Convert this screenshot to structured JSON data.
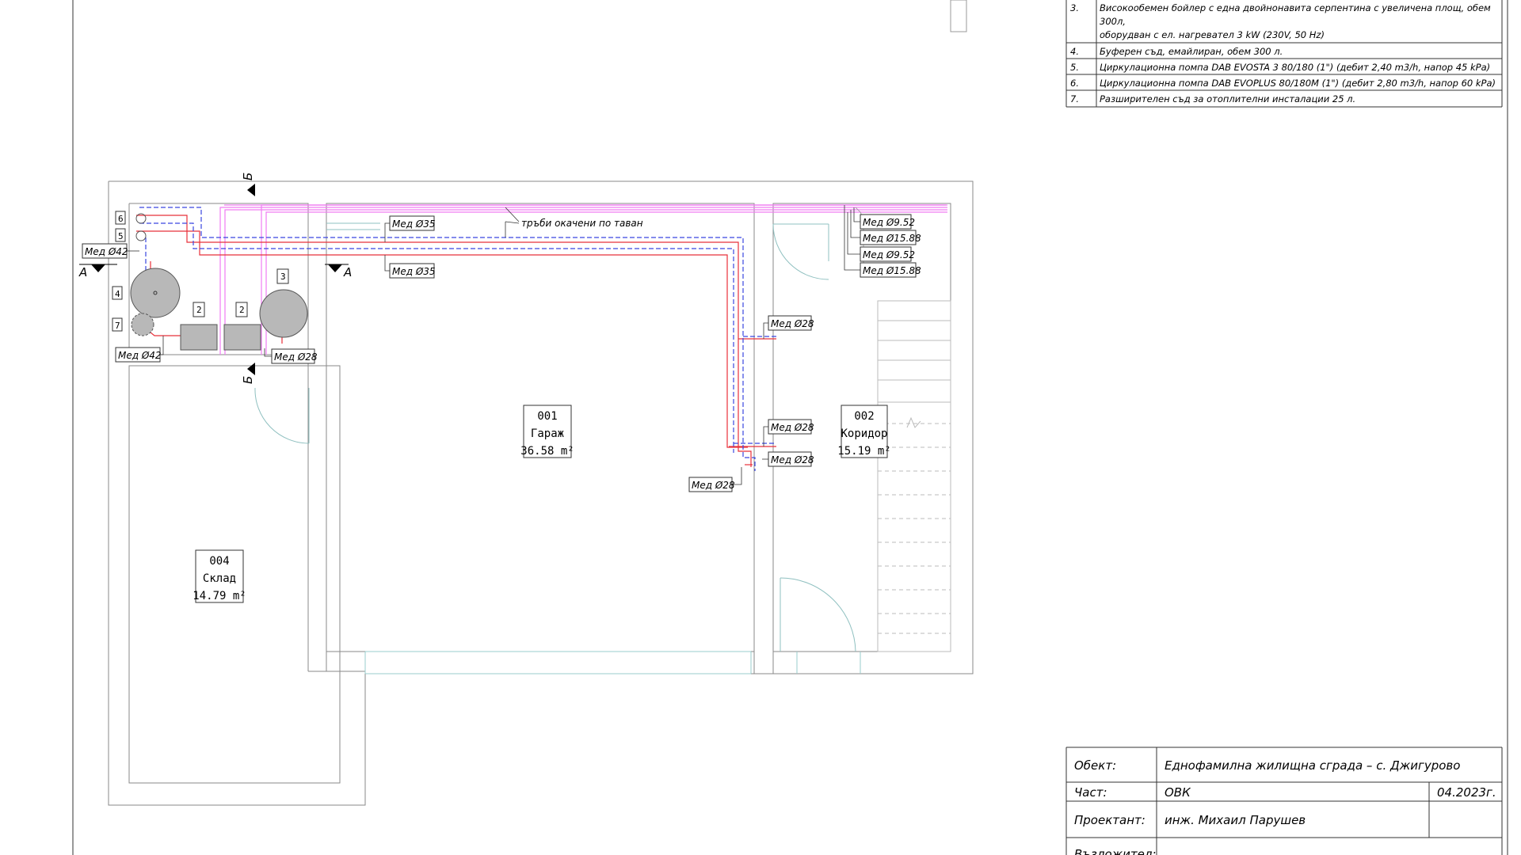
{
  "legend": {
    "rows": [
      {
        "no": "3.",
        "lines": [
          "Високообемен бойлер с една двойнонавита серпентина с увеличена площ, обем",
          "300л,",
          "оборудван с ел. нагревател 3 kW (230V, 50 Hz)"
        ]
      },
      {
        "no": "4.",
        "lines": [
          "Буферен съд, емайлиран, обем 300 л."
        ]
      },
      {
        "no": "5.",
        "lines": [
          "Циркулационна помпа DAB EVOSTA 3 80/180 (1\") (дебит 2,40 m3/h, напор 45 kPa)"
        ]
      },
      {
        "no": "6.",
        "lines": [
          "Циркулационна помпа DAB EVOPLUS 80/180M (1\") (дебит 2,80 m3/h, напор 60 kPa)"
        ]
      },
      {
        "no": "7.",
        "lines": [
          "Разширителен съд за отоплителни инсталации 25 л."
        ]
      }
    ]
  },
  "rooms": {
    "r001": {
      "num": "001",
      "name": "Гараж",
      "area": "36.58 m²"
    },
    "r002": {
      "num": "002",
      "name": "Коридор",
      "area": "15.19 m²"
    },
    "r004": {
      "num": "004",
      "name": "Склад",
      "area": "14.79 m²"
    }
  },
  "labels": {
    "ceiling_note": "тръби окачени по таван",
    "pipe_35a": "Мед Ø35",
    "pipe_35b": "Мед Ø35",
    "pipe_952a": "Мед Ø9.52",
    "pipe_1588a": "Мед Ø15.88",
    "pipe_952b": "Мед Ø9.52",
    "pipe_1588b": "Мед Ø15.88",
    "pipe_28a": "Мед Ø28",
    "pipe_28b": "Мед Ø28",
    "pipe_28c": "Мед Ø28",
    "pipe_28d": "Мед Ø28",
    "pipe_28e": "Мед Ø28",
    "pipe_42a": "Мед Ø42",
    "pipe_42b": "Мед Ø42"
  },
  "equipment_tags": {
    "t2a": "2",
    "t2b": "2",
    "t3": "3",
    "t4": "4",
    "t5": "5",
    "t6": "6",
    "t7": "7"
  },
  "sections": {
    "a_left": "А",
    "a_right": "А",
    "b_top": "Б",
    "b_bottom": "Б"
  },
  "title_block": {
    "object_label": "Обект:",
    "object_value": "Еднофамилна жилищна сграда –  с. Джигурово",
    "part_label": "Част:",
    "part_value": "ОВК",
    "date": "04.2023г.",
    "designer_label": "Проектант:",
    "designer_value": "инж. Михаил Парушев",
    "next_label": "Възложител:"
  },
  "colors": {
    "supply": "#e8303a",
    "return": "#3a46e0",
    "magenta": "#f07cf2",
    "wall": "#9a9a9a",
    "equipment": "#b8b8b8"
  }
}
